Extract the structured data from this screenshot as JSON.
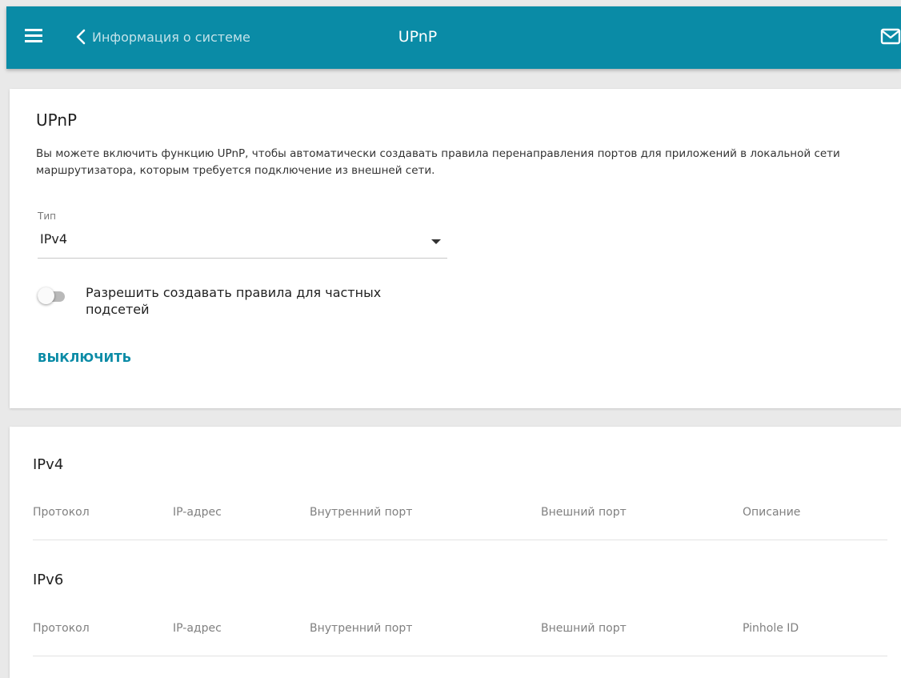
{
  "header": {
    "back_label": "Информация о системе",
    "title": "UPnP",
    "icons": {
      "menu": "menu-icon",
      "back": "chevron-left-icon",
      "mail": "mail-icon"
    },
    "accent_color": "#0a8ba6"
  },
  "upnp_card": {
    "title": "UPnP",
    "description": "Вы можете включить функцию UPnP, чтобы автоматически создавать правила перенаправления портов для приложений в локальной сети маршрутизатора, которым требуется подключение из внешней сети.",
    "type_label": "Тип",
    "type_value": "IPv4",
    "toggle_label": "Разрешить создавать правила для частных подсетей",
    "toggle_state": "off",
    "disable_button": "ВЫКЛЮЧИТЬ"
  },
  "tables": {
    "ipv4": {
      "title": "IPv4",
      "columns": [
        "Протокол",
        "IP-адрес",
        "Внутренний порт",
        "Внешний порт",
        "Описание"
      ]
    },
    "ipv6": {
      "title": "IPv6",
      "columns": [
        "Протокол",
        "IP-адрес",
        "Внутренний порт",
        "Внешний порт",
        "Pinhole ID"
      ]
    }
  }
}
